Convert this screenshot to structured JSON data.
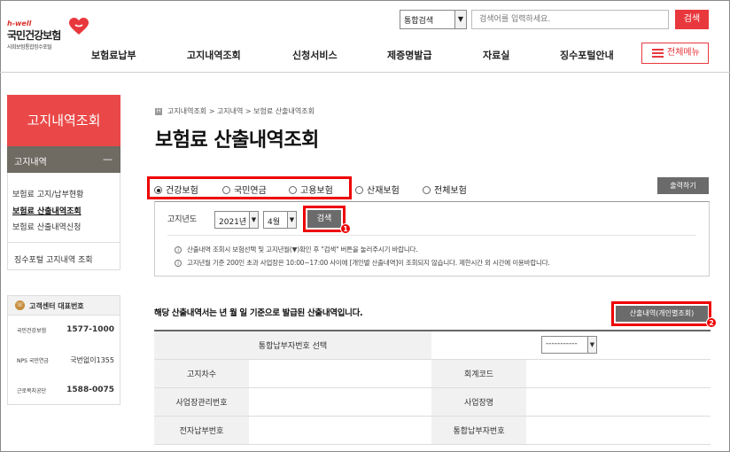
{
  "header": {
    "logo_hwell": "h-well",
    "logo_name": "국민건강보험",
    "logo_sub": "사회보험통합징수포털",
    "search_scope": "통합검색",
    "search_placeholder": "검색어를 입력하세요.",
    "search_button": "검색",
    "all_menu": "전체메뉴"
  },
  "gnb": [
    "보험료납부",
    "고지내역조회",
    "신청서비스",
    "제증명발급",
    "자료실",
    "징수포털안내"
  ],
  "sidebar": {
    "title": "고지내역조회",
    "section": "고지내역",
    "items": [
      "보험료 고지/납부현황",
      "보험료 산출내역조회",
      "보험료 산출내역신청"
    ],
    "portal_link": "징수포털 고지내역 조회"
  },
  "contact": {
    "title": "고객센터 대표번호",
    "rows": [
      {
        "org": "국민건강보험",
        "num": "1577-1000"
      },
      {
        "org": "NPS 국민연금",
        "num": "국번없이1355"
      },
      {
        "org": "근로복지공단",
        "num": "1588-0075"
      }
    ]
  },
  "main": {
    "breadcrumb": "고지내역조회 > 고지내역 > 보험료 산출내역조회",
    "title": "보험료 산출내역조회",
    "insurance_types": [
      {
        "label": "건강보험",
        "selected": true
      },
      {
        "label": "국민연금",
        "selected": false
      },
      {
        "label": "고용보험",
        "selected": false
      },
      {
        "label": "산재보험",
        "selected": false
      },
      {
        "label": "전체보험",
        "selected": false
      }
    ],
    "print_button": "출력하기",
    "filter": {
      "label": "고지년도",
      "year": "2021년",
      "month": "4월",
      "search_button": "검색",
      "notes": [
        "산출내역 조회시 보험선택 및 고지년월(▼)확인 후 \"검색\" 버튼을 눌러주시기 바랍니다.",
        "고지년월 기준 200인 초과 사업장은 10:00~17:00 사이에 [개인별 산출내역]이 조회되지 않습니다. 제한시간 외 시간에 이용바랍니다."
      ]
    },
    "notice": "해당 산출내역서는 년 월 일 기준으로 발급된 산출내역입니다.",
    "individual_button": "산출내역(개인별조회)",
    "table": {
      "payer_select_label": "통합납부자번호 선택",
      "payer_select_value": "-----------",
      "rows": [
        {
          "l1": "고지차수",
          "l2": "회계코드"
        },
        {
          "l1": "사업장관리번호",
          "l2": "사업장명"
        },
        {
          "l1": "전자납부번호",
          "l2": "통합납부자번호"
        }
      ]
    }
  },
  "annotations": [
    "1",
    "2"
  ],
  "colors": {
    "accent": "#e8383d",
    "sidebar_sub": "#6f6a62",
    "button_gray": "#6b6b6b",
    "highlight": "#ee0000"
  }
}
